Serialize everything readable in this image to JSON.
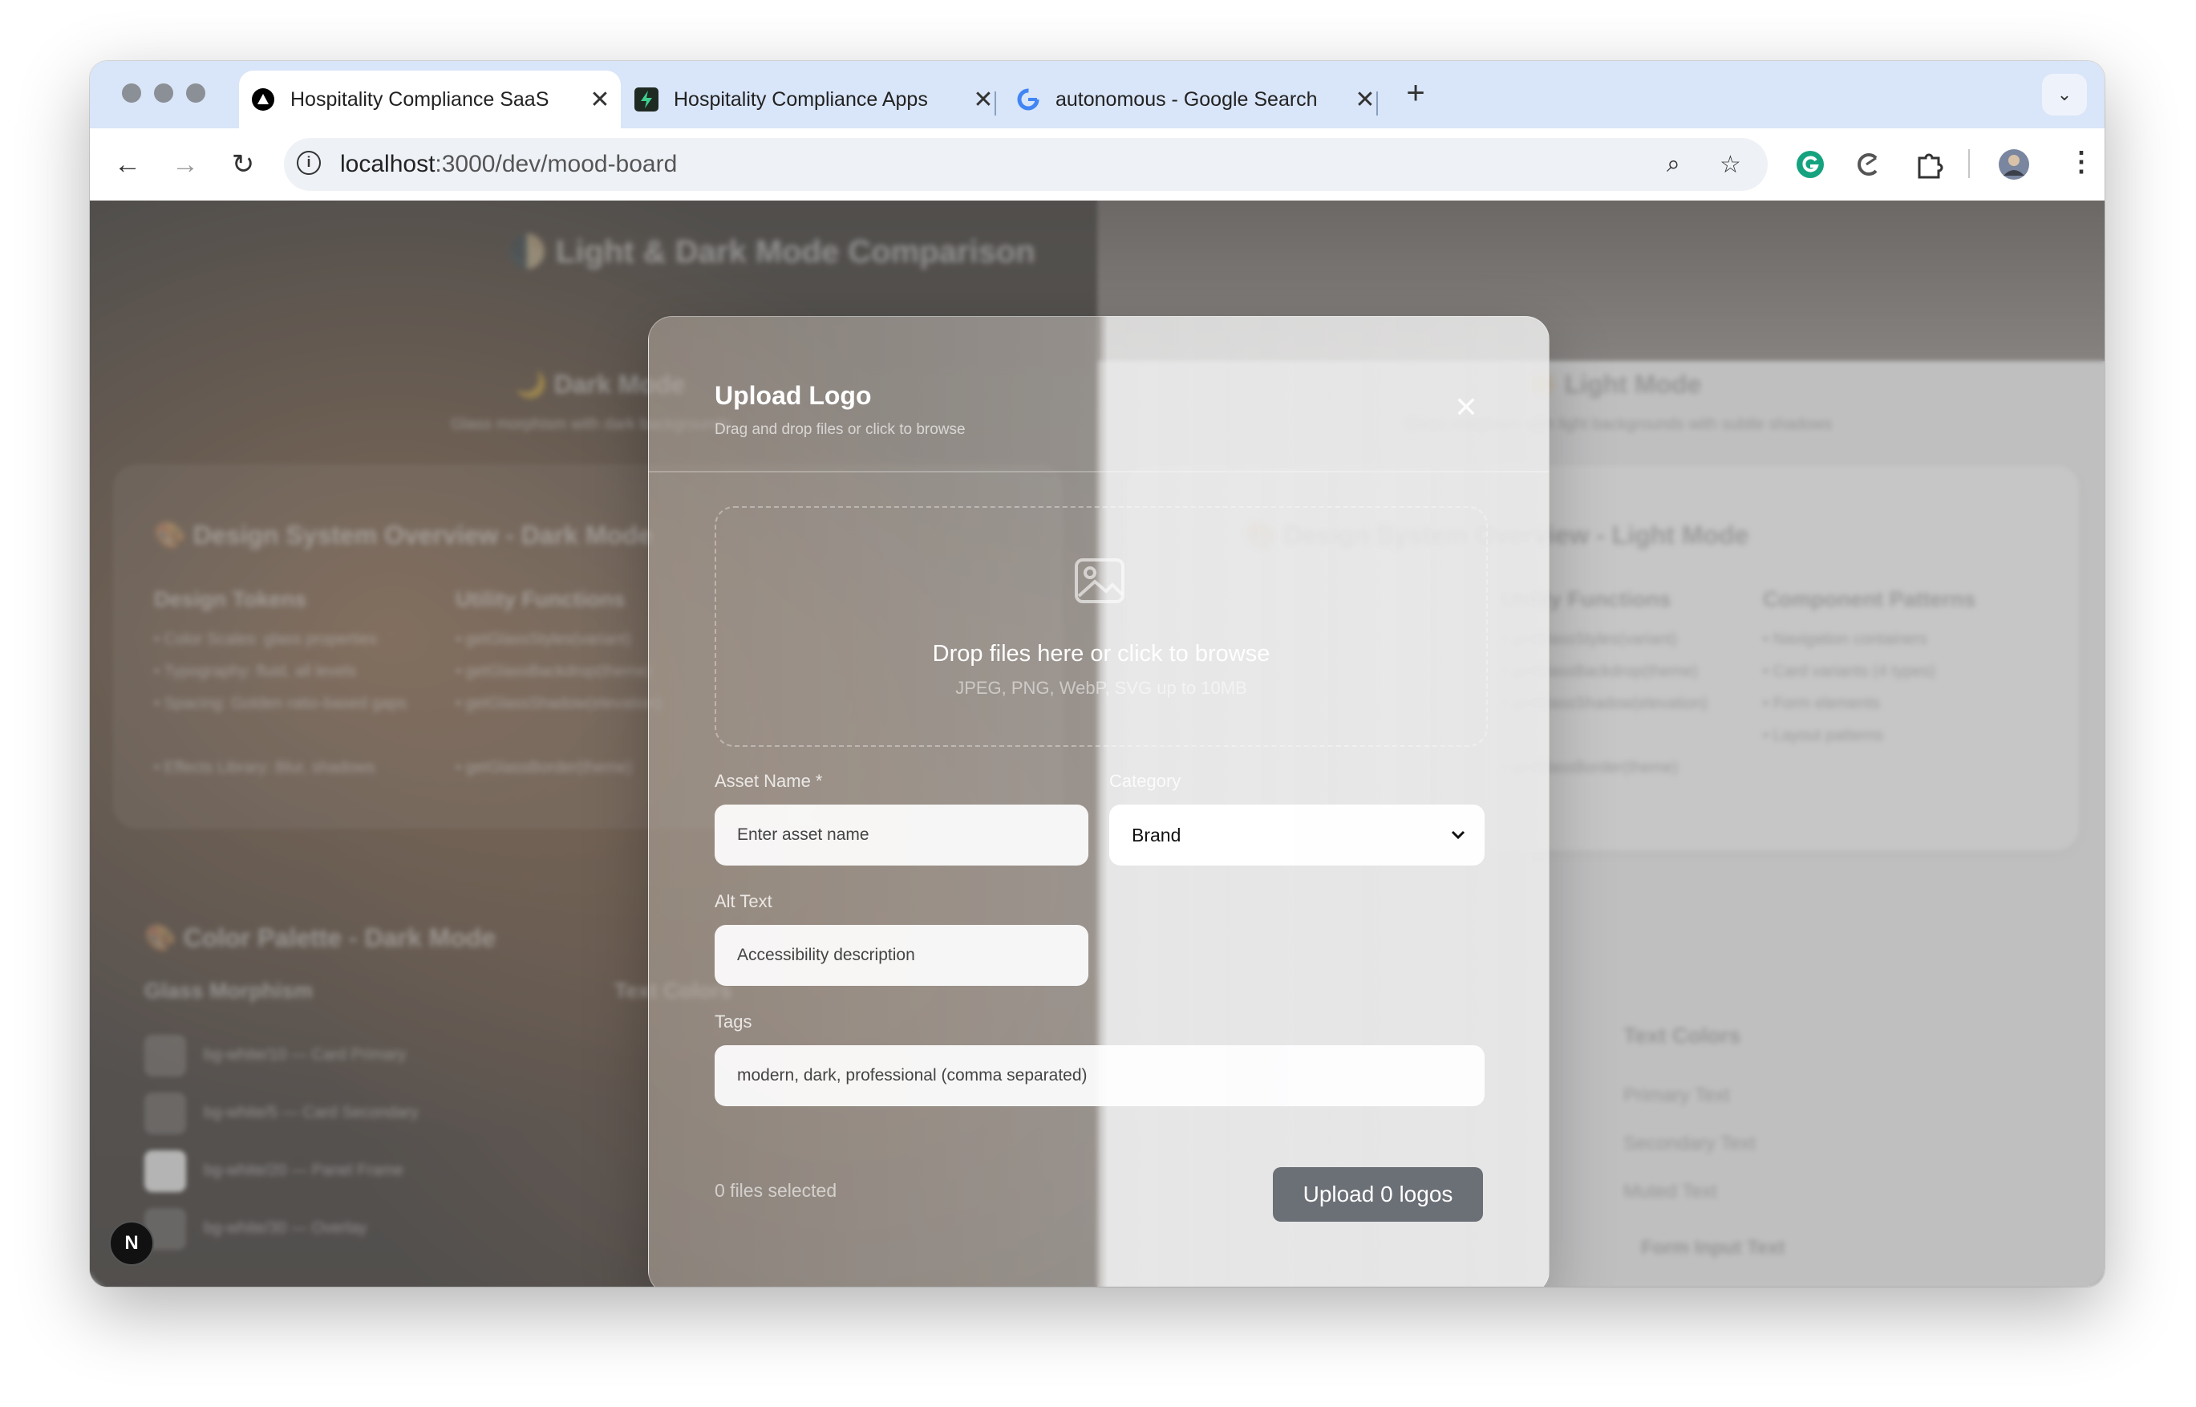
{
  "browser": {
    "tabs": [
      {
        "title": "Hospitality Compliance SaaS",
        "active": true
      },
      {
        "title": "Hospitality Compliance Apps",
        "active": false
      },
      {
        "title": "autonomous - Google Search",
        "active": false
      }
    ],
    "new_tab": "+",
    "tab_menu": "⌄",
    "close_glyph": "✕",
    "url_host": "localhost",
    "url_rest": ":3000/dev/mood-board",
    "nav": {
      "back": "←",
      "forward": "→",
      "reload": "↻"
    },
    "zoom_icon": "⌕",
    "bookmark_icon": "☆",
    "menu_icon": "⋮"
  },
  "background_page": {
    "header_title": "🌓 Light & Dark Mode Comparison",
    "dark_heading": "🌙 Dark Mode",
    "dark_sub": "Glass morphism with dark backgrounds",
    "light_heading": "☀️ Light Mode",
    "light_sub": "Glass morphism with light backgrounds with subtle shadows",
    "overview_dark": "🎨 Design System Overview - Dark Mode",
    "overview_light": "🎨 Design System Overview - Light Mode",
    "design_tokens": "Design Tokens",
    "utility_functions": "Utility Functions",
    "component_patterns": "Component Patterns",
    "tokens_list": [
      "• Color Scales: glass properties",
      "• Typography: fluid, all levels",
      "• Spacing: Golden ratio-based gaps",
      "• Effects Library: Blur, shadows"
    ],
    "utility_list": [
      "• getGlassStyles(variant)",
      "• getGlassBackdrop(theme)",
      "• getGlassShadow(elevation)",
      "• getGlassBorder(theme)"
    ],
    "patterns_list": [
      "• Navigation containers",
      "• Card variants (4 types)",
      "• Form elements",
      "• Layout patterns"
    ],
    "palette_dark": "🎨 Color Palette - Dark Mode",
    "glass_morphism": "Glass Morphism",
    "text_colors": "Text Colors",
    "swatches": [
      "bg-white/10 — Card Primary",
      "bg-white/5 — Card Secondary",
      "bg-white/20 — Panel Frame",
      "bg-white/30 — Overlay"
    ],
    "text_color_rows": [
      "Primary Text",
      "Secondary Text",
      "Muted Text",
      "Form Input Text"
    ]
  },
  "modal": {
    "title": "Upload Logo",
    "subtitle": "Drag and drop files or click to browse",
    "close": "✕",
    "dropzone_main": "Drop files here or click to browse",
    "dropzone_sub": "JPEG, PNG, WebP, SVG up to 10MB",
    "asset_name_label": "Asset Name *",
    "asset_name_placeholder": "Enter asset name",
    "category_label": "Category",
    "category_value": "Brand",
    "alt_text_label": "Alt Text",
    "alt_text_placeholder": "Accessibility description",
    "tags_label": "Tags",
    "tags_placeholder": "modern, dark, professional (comma separated)",
    "files_selected": "0 files selected",
    "upload_button": "Upload 0 logos"
  },
  "dev_badge": "N"
}
